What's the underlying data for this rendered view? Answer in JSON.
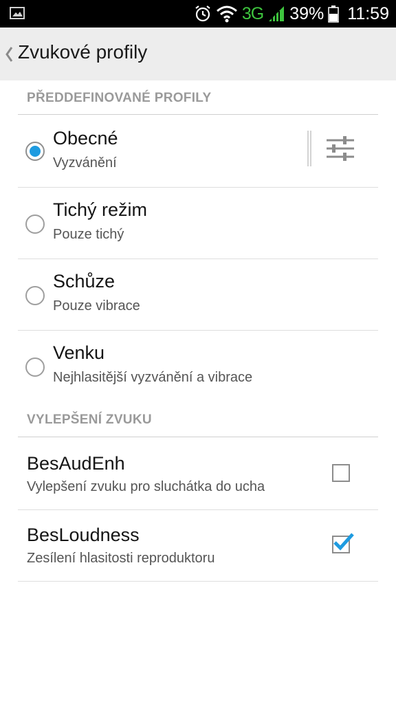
{
  "status_bar": {
    "network": "3G",
    "battery_percent": "39%",
    "time": "11:59",
    "icons": [
      "image-icon",
      "alarm-icon",
      "wifi-icon",
      "signal-icon",
      "battery-icon"
    ]
  },
  "action_bar": {
    "title": "Zvukové profily"
  },
  "sections": {
    "predefined": {
      "header": "PŘEDDEFINOVANÉ PROFILY",
      "items": [
        {
          "title": "Obecné",
          "subtitle": "Vyzvánění",
          "selected": true
        },
        {
          "title": "Tichý režim",
          "subtitle": "Pouze tichý",
          "selected": false
        },
        {
          "title": "Schůze",
          "subtitle": "Pouze vibrace",
          "selected": false
        },
        {
          "title": "Venku",
          "subtitle": "Nejhlasitější vyzvánění a vibrace",
          "selected": false
        }
      ]
    },
    "enhancement": {
      "header": "VYLEPŠENÍ ZVUKU",
      "items": [
        {
          "title": "BesAudEnh",
          "subtitle": "Vylepšení zvuku pro sluchátka do ucha",
          "checked": false
        },
        {
          "title": "BesLoudness",
          "subtitle": "Zesílení hlasitosti reproduktoru",
          "checked": true
        }
      ]
    }
  },
  "colors": {
    "accent": "#1e9be0",
    "network": "#3ec43e",
    "action_bar_bg": "#ededed",
    "section_header": "#9a9a9a"
  }
}
